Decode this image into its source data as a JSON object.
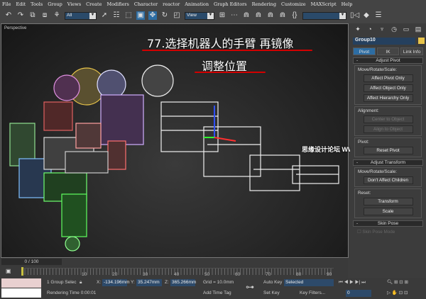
{
  "menu": [
    "File",
    "Edit",
    "Tools",
    "Group",
    "Views",
    "Create",
    "Modifiers",
    "Character",
    "reactor",
    "Animation",
    "Graph Editors",
    "Rendering",
    "Customize",
    "MAXScript",
    "Help"
  ],
  "toolbar": {
    "filter": "All",
    "coord": "View",
    "named_sel": ""
  },
  "viewport": {
    "label": "Perspective"
  },
  "annotation": {
    "line1": "77.选择机器人的手臂 再镜像",
    "line2": "调整位置",
    "underline_color": "#d20000"
  },
  "watermark": "思缘设计论坛 WWW.MISSYUAN.COM",
  "panel": {
    "object_name": "Group10",
    "object_color": "#e8c44a",
    "tabs": [
      "Pivot",
      "IK",
      "Link Info"
    ],
    "adjust_pivot": {
      "title": "Adjust Pivot",
      "mrs": "Move/Rotate/Scale:",
      "buttons": [
        "Affect Pivot Only",
        "Affect Object Only",
        "Affect Hierarchy Only"
      ],
      "alignment": "Alignment:",
      "align_buttons": [
        "Center to Object",
        "Align to Object"
      ],
      "pivot": "Pivot:",
      "reset": "Reset Pivot"
    },
    "adjust_transform": {
      "title": "Adjust Transform",
      "mrs": "Move/Rotate/Scale:",
      "dont": "Don't Affect Children",
      "reset": "Reset:",
      "transform": "Transform",
      "scale": "Scale"
    },
    "skin_pose": {
      "title": "Skin Pose",
      "mode": "Skin Pose Mode"
    }
  },
  "timeline": {
    "position": "0 / 100",
    "ticks": [
      "10",
      "20",
      "30",
      "40",
      "50",
      "60",
      "70",
      "80",
      "90",
      "100"
    ]
  },
  "status": {
    "selection": "1 Group Selec",
    "x": "-134.196mm",
    "y": "35.247mm",
    "z": "365.266mm",
    "grid": "Grid = 10.0mm",
    "render_time": "Rendering Time  0:00:01",
    "add_time_tag": "Add Time Tag",
    "auto_key": "Auto Key",
    "set_key": "Set Key",
    "key_mode": "Selected",
    "key_filters": "Key Filters...",
    "frame": "0"
  }
}
